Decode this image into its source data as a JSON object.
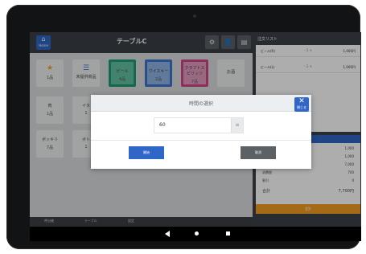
{
  "header": {
    "title": "テーブルC",
    "home_label": "Home",
    "icons": [
      "settings-icon",
      "user-icon",
      "document-icon"
    ]
  },
  "tiles": [
    {
      "label": "",
      "count": "1品",
      "icon": "star-icon",
      "style": "gray"
    },
    {
      "label": "未提供商品",
      "count": "",
      "icon": "list-icon",
      "style": "gray"
    },
    {
      "label": "ビール",
      "count": "4品",
      "icon": "",
      "style": "green"
    },
    {
      "label": "ウイスキー",
      "count": "2品",
      "icon": "",
      "style": "blue"
    },
    {
      "label": "クラフトスピリッツ",
      "count": "7品",
      "icon": "",
      "style": "pink"
    },
    {
      "label": "お酒",
      "count": "",
      "icon": "",
      "style": "gray"
    },
    {
      "label": "肉",
      "count": "1品",
      "icon": "",
      "style": "gray"
    },
    {
      "label": "イタ",
      "count": "1",
      "icon": "",
      "style": "gray"
    },
    {
      "label": "ポッキリ",
      "count": "7品",
      "icon": "",
      "style": "gray"
    },
    {
      "label": "ボト",
      "count": "1",
      "icon": "",
      "style": "gray"
    }
  ],
  "bottom_nav": [
    "呼出確",
    "テーブル",
    "設定"
  ],
  "order_panel": {
    "title": "注文リスト",
    "items": [
      {
        "name": "ビール(R)",
        "qty": "- 1 +",
        "price": "1,000円"
      },
      {
        "name": "ビール(L)",
        "qty": "- 1 +",
        "price": "1,000円"
      }
    ],
    "summary_rows": [
      {
        "label": "",
        "value": "1,000"
      },
      {
        "label": "",
        "value": "1,000"
      },
      {
        "label": "小計(税抜)",
        "value": "7,000"
      },
      {
        "label": "消費税",
        "value": "700"
      },
      {
        "label": "割引",
        "value": "0"
      },
      {
        "label": "合計",
        "value": "7,700円"
      }
    ],
    "pay_label": "会計"
  },
  "dialog": {
    "title": "時間の選択",
    "close_label": "閉じる",
    "selected_value": "60",
    "start_label": "開始",
    "cancel_label": "取消"
  }
}
